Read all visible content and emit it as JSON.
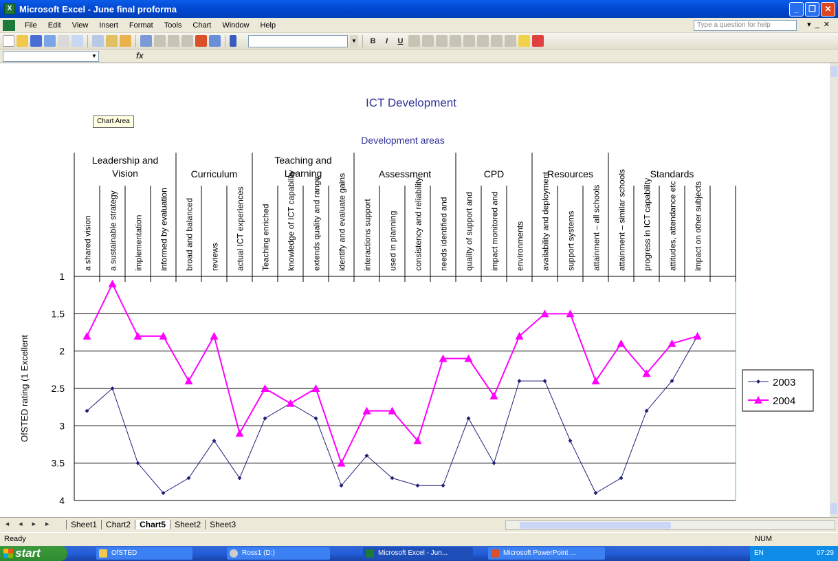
{
  "window": {
    "title": "Microsoft Excel - June final proforma"
  },
  "menu": {
    "items": [
      "File",
      "Edit",
      "View",
      "Insert",
      "Format",
      "Tools",
      "Chart",
      "Window",
      "Help"
    ],
    "help_placeholder": "Type a question for help"
  },
  "formula": {
    "fx_label": "fx"
  },
  "chart_tip": "Chart Area",
  "chart_data": {
    "type": "line",
    "title": "ICT Development",
    "x_axis_title": "Development areas",
    "ylabel": "OfSTED rating (1 Excellent",
    "ylim": [
      1,
      4
    ],
    "y_reversed": true,
    "y_ticks": [
      "1",
      "1.5",
      "2",
      "2.5",
      "3",
      "3.5",
      "4"
    ],
    "grid": true,
    "legend_position": "right",
    "groups": [
      {
        "label": "Leadership and Vision",
        "start": 0,
        "end": 3
      },
      {
        "label": "Curriculum",
        "start": 4,
        "end": 6
      },
      {
        "label": "Teaching and Learning",
        "start": 7,
        "end": 10
      },
      {
        "label": "Assessment",
        "start": 11,
        "end": 14
      },
      {
        "label": "CPD",
        "start": 15,
        "end": 17
      },
      {
        "label": "Resources",
        "start": 18,
        "end": 20
      },
      {
        "label": "Standards",
        "start": 21,
        "end": 25
      }
    ],
    "categories": [
      "a shared vision",
      "a sustainable strategy",
      "implementation",
      "informed by evaluation",
      "broad and balanced",
      "reviews",
      "actual ICT experiences",
      "Teaching enriched",
      "knowledge of ICT capability",
      "extends quality and range",
      "identify and evaluate gains",
      "interactions support",
      "used in planning",
      "consistency and reliability",
      "needs identified and",
      "quality of support and",
      "impact monitored and",
      "environments",
      "availability and deployment",
      "support systems",
      "attainment – all schools",
      "attainment – similar schools",
      "progress in ICT capability",
      "attitudes, attendance etc",
      "impact on other subjects",
      ""
    ],
    "series": [
      {
        "name": "2003",
        "color": "#1f1f7a",
        "marker": "diamond",
        "values": [
          2.8,
          2.5,
          3.5,
          3.9,
          3.7,
          3.2,
          3.7,
          2.9,
          2.7,
          2.9,
          3.8,
          3.4,
          3.7,
          3.8,
          3.8,
          2.9,
          3.5,
          2.4,
          2.4,
          3.2,
          3.9,
          3.7,
          2.8,
          2.4,
          1.8
        ]
      },
      {
        "name": "2004",
        "color": "#ff00ff",
        "marker": "triangle",
        "values": [
          1.8,
          1.1,
          1.8,
          1.8,
          2.4,
          1.8,
          3.1,
          2.5,
          2.7,
          2.5,
          3.5,
          2.8,
          2.8,
          3.2,
          2.1,
          2.1,
          2.6,
          1.8,
          1.5,
          1.5,
          2.4,
          1.9,
          2.3,
          1.9,
          1.8
        ]
      }
    ]
  },
  "sheets": {
    "nav": "◄ ◄ ► ►",
    "tabs": [
      "Sheet1",
      "Chart2",
      "Chart5",
      "Sheet2",
      "Sheet3"
    ],
    "active": "Chart5"
  },
  "status": {
    "left": "Ready",
    "right": "NUM"
  },
  "taskbar": {
    "start": "start",
    "items": [
      "OfSTED",
      "Ross1 (D:)",
      "Microsoft Excel - Jun...",
      "Microsoft PowerPoint ..."
    ],
    "lang": "EN",
    "clock": "07:29"
  }
}
